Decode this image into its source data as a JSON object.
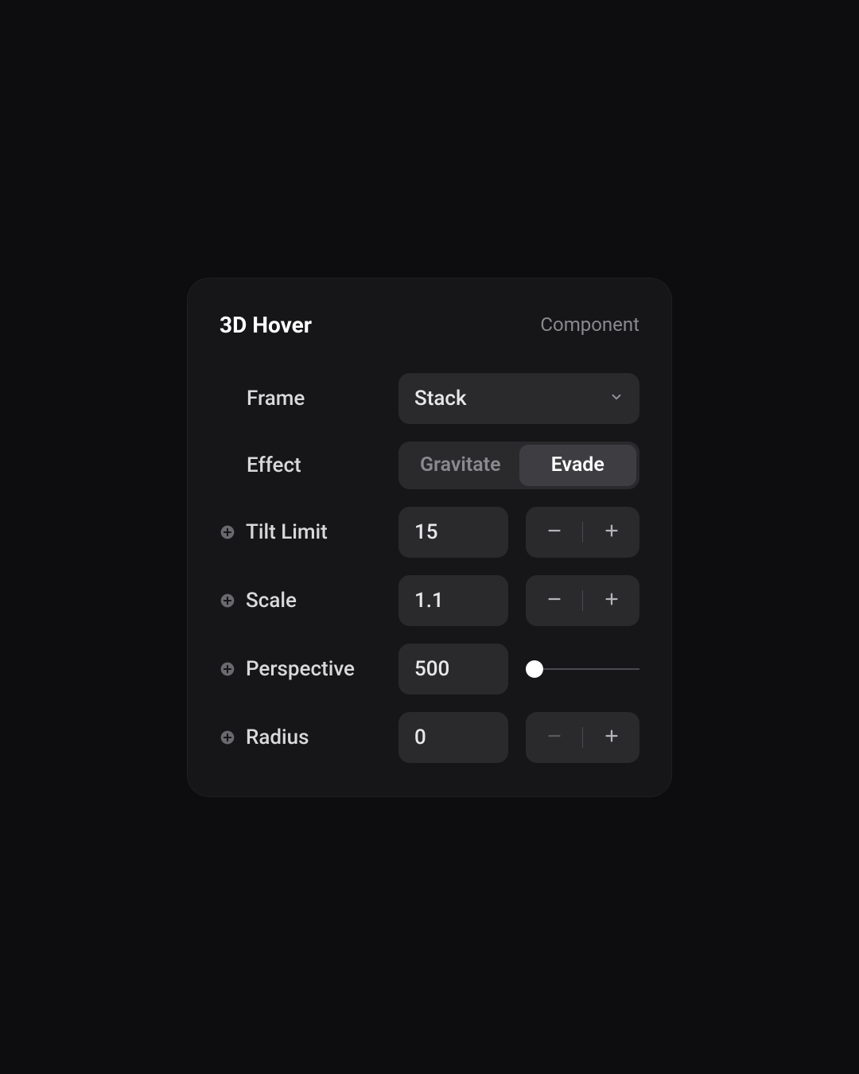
{
  "header": {
    "title": "3D Hover",
    "subtitle": "Component"
  },
  "frame": {
    "label": "Frame",
    "value": "Stack"
  },
  "effect": {
    "label": "Effect",
    "options": [
      "Gravitate",
      "Evade"
    ],
    "selected": "Evade"
  },
  "tilt_limit": {
    "label": "Tilt Limit",
    "value": "15"
  },
  "scale": {
    "label": "Scale",
    "value": "1.1"
  },
  "perspective": {
    "label": "Perspective",
    "value": "500"
  },
  "radius": {
    "label": "Radius",
    "value": "0"
  }
}
